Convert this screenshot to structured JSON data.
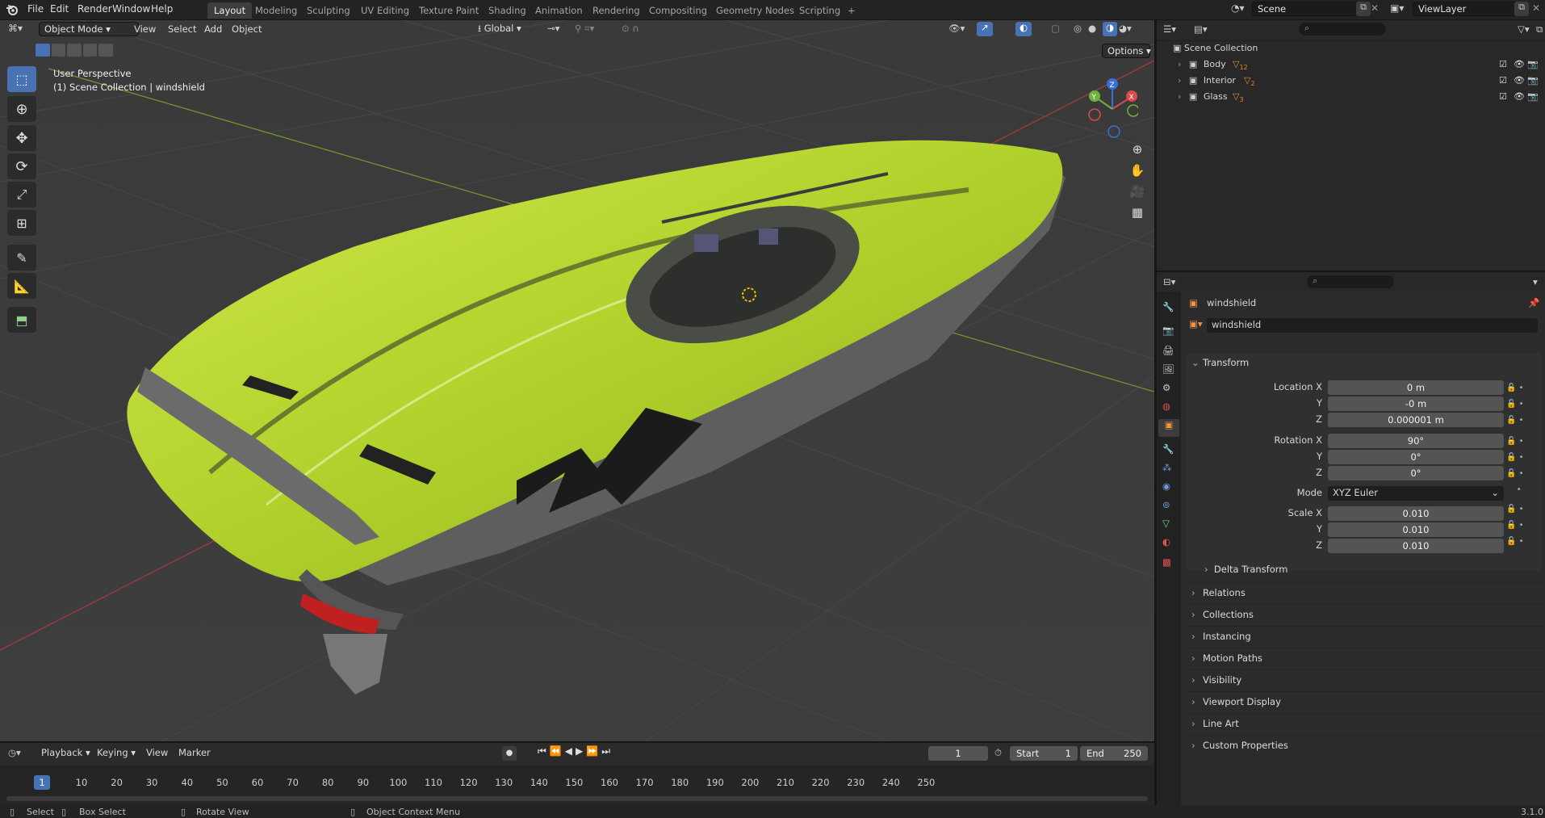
{
  "menu": {
    "file": "File",
    "edit": "Edit",
    "render": "Render",
    "window": "Window",
    "help": "Help"
  },
  "workspaces": [
    "Layout",
    "Modeling",
    "Sculpting",
    "UV Editing",
    "Texture Paint",
    "Shading",
    "Animation",
    "Rendering",
    "Compositing",
    "Geometry Nodes",
    "Scripting",
    "+"
  ],
  "scene": {
    "name": "Scene",
    "viewlayer": "ViewLayer"
  },
  "viewport": {
    "mode": "Object Mode",
    "view": "View",
    "select": "Select",
    "add": "Add",
    "object": "Object",
    "orientation": "Global",
    "options": "Options",
    "perspective": "User Perspective",
    "collection_info": "(1) Scene Collection | windshield",
    "gizmo_x": "X",
    "gizmo_y": "Y",
    "gizmo_z": "Z",
    "decal_text": "SV"
  },
  "outliner": {
    "root": "Scene Collection",
    "items": [
      {
        "name": "Body",
        "count": "12"
      },
      {
        "name": "Interior",
        "count": "2"
      },
      {
        "name": "Glass",
        "count": "3"
      }
    ]
  },
  "properties": {
    "object_name": "windshield",
    "data_name": "windshield",
    "transform_title": "Transform",
    "location": {
      "label_x": "Location X",
      "label_y": "Y",
      "label_z": "Z",
      "x": "0 m",
      "y": "-0 m",
      "z": "0.000001 m"
    },
    "rotation": {
      "label_x": "Rotation X",
      "label_y": "Y",
      "label_z": "Z",
      "x": "90°",
      "y": "0°",
      "z": "0°"
    },
    "mode_label": "Mode",
    "mode_value": "XYZ Euler",
    "scale": {
      "label_x": "Scale X",
      "label_y": "Y",
      "label_z": "Z",
      "x": "0.010",
      "y": "0.010",
      "z": "0.010"
    },
    "delta": "Delta Transform",
    "panels": [
      "Relations",
      "Collections",
      "Instancing",
      "Motion Paths",
      "Visibility",
      "Viewport Display",
      "Line Art",
      "Custom Properties"
    ]
  },
  "timeline": {
    "playback": "Playback",
    "keying": "Keying",
    "view": "View",
    "marker": "Marker",
    "current_frame": "1",
    "start_label": "Start",
    "start": "1",
    "end_label": "End",
    "end": "250",
    "ticks": [
      "1",
      "10",
      "20",
      "30",
      "40",
      "50",
      "60",
      "70",
      "80",
      "90",
      "100",
      "110",
      "120",
      "130",
      "140",
      "150",
      "160",
      "170",
      "180",
      "190",
      "200",
      "210",
      "220",
      "230",
      "240",
      "250"
    ]
  },
  "status": {
    "select": "Select",
    "box_select": "Box Select",
    "rotate_view": "Rotate View",
    "context_menu": "Object Context Menu",
    "version": "3.1.0"
  },
  "colors": {
    "accent": "#4772b3",
    "boat": "#b9d832",
    "grid_x": "#b53a3a",
    "grid_y": "#7fa33a"
  }
}
